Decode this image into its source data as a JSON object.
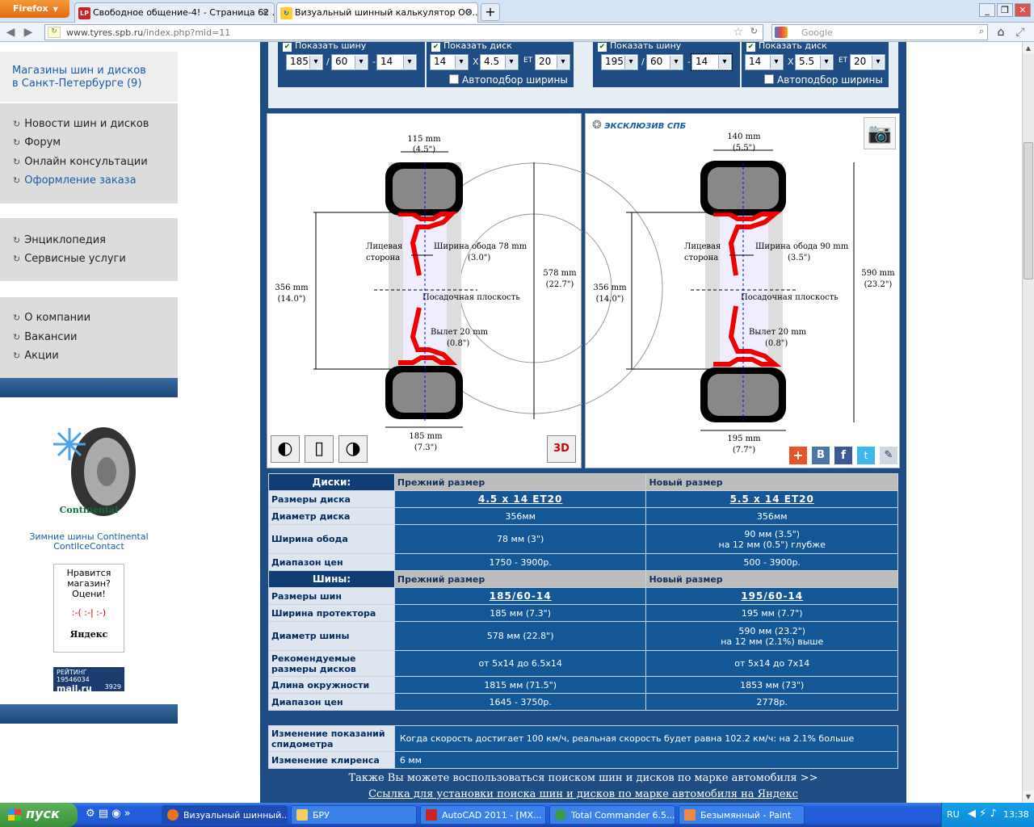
{
  "browser": {
    "menu_label": "Firefox",
    "tabs": [
      {
        "label": "Свободное общение-4! - Страница 62 ...",
        "favicon": "LP"
      },
      {
        "label": "Визуальный шинный калькулятор ОО..."
      }
    ],
    "url_host": "www.tyres.spb.ru",
    "url_path": "/index.php?mid=11",
    "search_placeholder": "Google"
  },
  "sidebar": {
    "title_line1": "Магазины шин и дисков",
    "title_line2": "в Санкт-Петербурге (9)",
    "group1": [
      "Новости шин и дисков",
      "Форум",
      "Онлайн консультации",
      "Оформление заказа"
    ],
    "group2": [
      "Энциклопедия",
      "Сервисные услуги"
    ],
    "group3": [
      "О компании",
      "Вакансии",
      "Акции"
    ],
    "promo_brand": "Continental",
    "promo_model": "ContiIceContact",
    "promo_caption1": "Зимние шины Continental",
    "promo_caption2": "ContiIceContact",
    "rating_line1": "Нравится",
    "rating_line2": "магазин?",
    "rating_line3": "Оцени!",
    "rating_faces": ":-(   :-|   :-)",
    "rating_brand": "Яндекс",
    "counter_label": "РЕЙТИНГ",
    "counter_id": "19546034",
    "counter_v1": "3929",
    "counter_v2": "1056",
    "counter_brand": "mail.ru"
  },
  "selector": {
    "show_tire": "Показать шину",
    "show_disk": "Показать диск",
    "auto_width": "Автоподбор ширины",
    "x_sep": "X",
    "et_label": "ET",
    "slash": "/",
    "dash": "-",
    "left": {
      "width": "185",
      "profile": "60",
      "rim": "14",
      "disk_d": "14",
      "disk_w": "4.5",
      "et": "20"
    },
    "right": {
      "width": "195",
      "profile": "60",
      "rim": "14",
      "disk_d": "14",
      "disk_w": "5.5",
      "et": "20"
    }
  },
  "diagrams": {
    "brand": "ЭКСКЛЮЗИВ СПБ",
    "left": {
      "rim_w": "115 mm",
      "rim_w_in": "(4.5\")",
      "bead_d": "356 mm",
      "bead_d_in": "(14.0\")",
      "outer_d": "578 mm",
      "outer_d_in": "(22.7\")",
      "tread": "185 mm",
      "tread_in": "(7.3\")",
      "rim_width_lbl": "Ширина обода 78 mm",
      "rim_width_in": "(3.0\")",
      "face_lbl1": "Лицевая",
      "face_lbl2": "сторона",
      "seat_lbl": "Посадочная плоскость",
      "offset_lbl": "Вылет 20 mm",
      "offset_in": "(0.8\")"
    },
    "right": {
      "rim_w": "140 mm",
      "rim_w_in": "(5.5\")",
      "bead_d": "356 mm",
      "bead_d_in": "(14.0\")",
      "outer_d": "590 mm",
      "outer_d_in": "(23.2\")",
      "tread": "195 mm",
      "tread_in": "(7.7\")",
      "rim_width_lbl": "Ширина обода 90 mm",
      "rim_width_in": "(3.5\")",
      "face_lbl1": "Лицевая",
      "face_lbl2": "сторона",
      "seat_lbl": "Посадочная плоскость",
      "offset_lbl": "Вылет 20 mm",
      "offset_in": "(0.8\")"
    },
    "view3d": "3D"
  },
  "table_disks": {
    "head": "Диски:",
    "old": "Прежний размер",
    "new": "Новый размер",
    "rows": [
      {
        "k": "Размеры диска",
        "old": "4.5 x 14 ET20",
        "new": "5.5 x 14 ET20"
      },
      {
        "k": "Диаметр диска",
        "old": "356мм",
        "new": "356мм"
      },
      {
        "k": "Ширина обода",
        "old": "78 мм (3\")",
        "new": "90 мм (3.5\")",
        "new2": "на 12 мм (0.5\") глубже"
      },
      {
        "k": "Диапазон цен",
        "old": "1750 - 3900р.",
        "new": "500 - 3900р."
      }
    ]
  },
  "table_tires": {
    "head": "Шины:",
    "old": "Прежний размер",
    "new": "Новый размер",
    "rows": [
      {
        "k": "Размеры шин",
        "old": "185/60-14",
        "new": "195/60-14"
      },
      {
        "k": "Ширина протектора",
        "old": "185 мм (7.3\")",
        "new": "195 мм (7.7\")"
      },
      {
        "k": "Диаметр шины",
        "old": "578 мм (22.8\")",
        "new": "590 мм (23.2\")",
        "new2": "на 12 мм (2.1%) выше"
      },
      {
        "k": "Рекомендуемые размеры дисков",
        "old": "от 5x14 до 6.5x14",
        "new": "от 5x14 до 7x14"
      },
      {
        "k": "Длина окружности",
        "old": "1815 мм (71.5\")",
        "new": "1853 мм (73\")"
      },
      {
        "k": "Диапазон цен",
        "old": "1645 - 3750р.",
        "new": "2778р."
      }
    ]
  },
  "table_extra": [
    {
      "k": "Изменение показаний спидометра",
      "v": "Когда скорость достигает 100 км/ч, реальная скорость будет равна 102.2 км/ч: на 2.1% больше"
    },
    {
      "k": "Изменение клиренса",
      "v": "6 мм"
    }
  ],
  "footer": {
    "line1": "Также Вы можете воспользоваться поиском шин и дисков по марке автомобиля >>",
    "line2": "Ссылка для установки поиска шин и дисков по марке автомобиля на Яндекс"
  },
  "taskbar": {
    "start": "пуск",
    "items": [
      "Визуальный шинный...",
      "БРУ",
      "AutoCAD 2011 - [MX...",
      "Total Commander 6.5...",
      "Безымянный - Paint"
    ],
    "lang": "RU",
    "clock": "13:38"
  }
}
